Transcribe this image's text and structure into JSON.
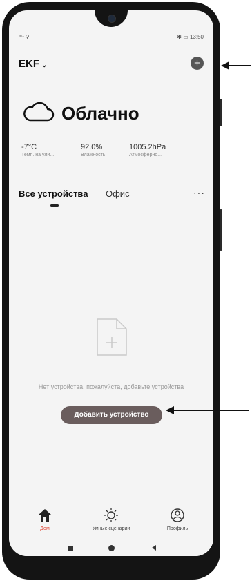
{
  "status": {
    "left": "⁴ᴳ ⚲",
    "right": "✱ ▭ 13:50"
  },
  "header": {
    "home_name": "EKF",
    "home_chevron": "⌄",
    "add_symbol": "+"
  },
  "weather": {
    "condition": "Облачно",
    "stats": [
      {
        "value": "-7°C",
        "label": "Темп. на ули..."
      },
      {
        "value": "92.0%",
        "label": "Влажность"
      },
      {
        "value": "1005.2hPa",
        "label": "Атмосферно..."
      }
    ]
  },
  "tabs": {
    "active": "Все устройства",
    "second": "Офис",
    "more": "···"
  },
  "empty_state": {
    "message": "Нет устройства, пожалуйста, добавьте устройства",
    "button": "Добавить устройство"
  },
  "bottom_nav": [
    {
      "label": "Дом",
      "icon": "home-icon",
      "active": true
    },
    {
      "label": "Умные сценарии",
      "icon": "lightbulb-icon",
      "active": false
    },
    {
      "label": "Профиль",
      "icon": "profile-icon",
      "active": false
    }
  ],
  "colors": {
    "accent": "#e04a3a",
    "button": "#6a5d5d",
    "frame": "#141414"
  }
}
